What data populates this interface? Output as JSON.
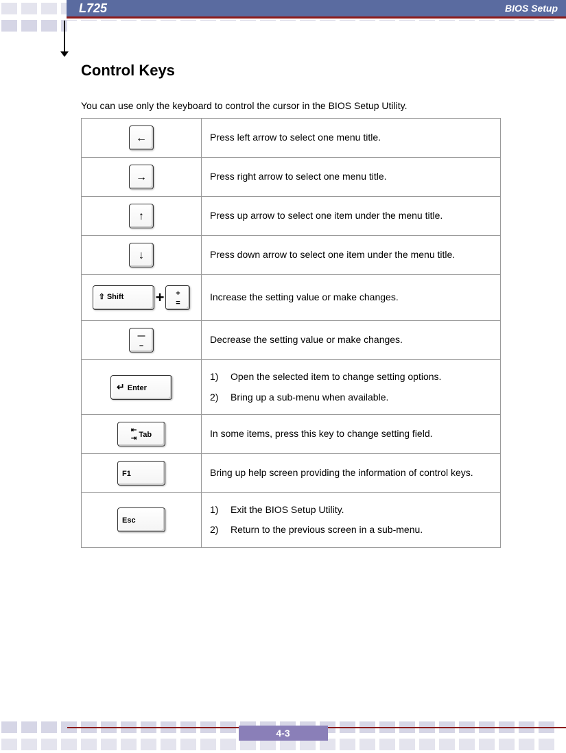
{
  "header": {
    "left": "L725",
    "right": "BIOS Setup"
  },
  "title": "Control Keys",
  "intro": "You can use only the keyboard to control the cursor in the BIOS Setup Utility.",
  "rows": {
    "r1": {
      "desc": "Press left arrow to select one menu title."
    },
    "r2": {
      "desc": "Press right arrow to select one menu title."
    },
    "r3": {
      "desc": "Press up arrow to select one item under the menu title."
    },
    "r4": {
      "desc": "Press down arrow to select one item under the menu title."
    },
    "r5": {
      "desc": "Increase the setting value or make changes."
    },
    "r6": {
      "desc": "Decrease the setting value or make changes."
    },
    "r7": {
      "i1": "Open the selected item to change setting options.",
      "i2": "Bring up a sub-menu when available."
    },
    "r8": {
      "desc": "In some items, press this key to change setting field."
    },
    "r9": {
      "desc": "Bring up help screen providing the information of control keys."
    },
    "r10": {
      "i1": "Exit the BIOS Setup Utility.",
      "i2": "Return to the previous screen in a sub-menu."
    }
  },
  "keys": {
    "shift": "⇧ Shift",
    "plus_top": "+",
    "plus_bot": "=",
    "minus_top": "—",
    "minus_bot": "–",
    "enter": "Enter",
    "tab": "Tab",
    "f1": "F1",
    "esc": "Esc"
  },
  "footer": "4-3"
}
